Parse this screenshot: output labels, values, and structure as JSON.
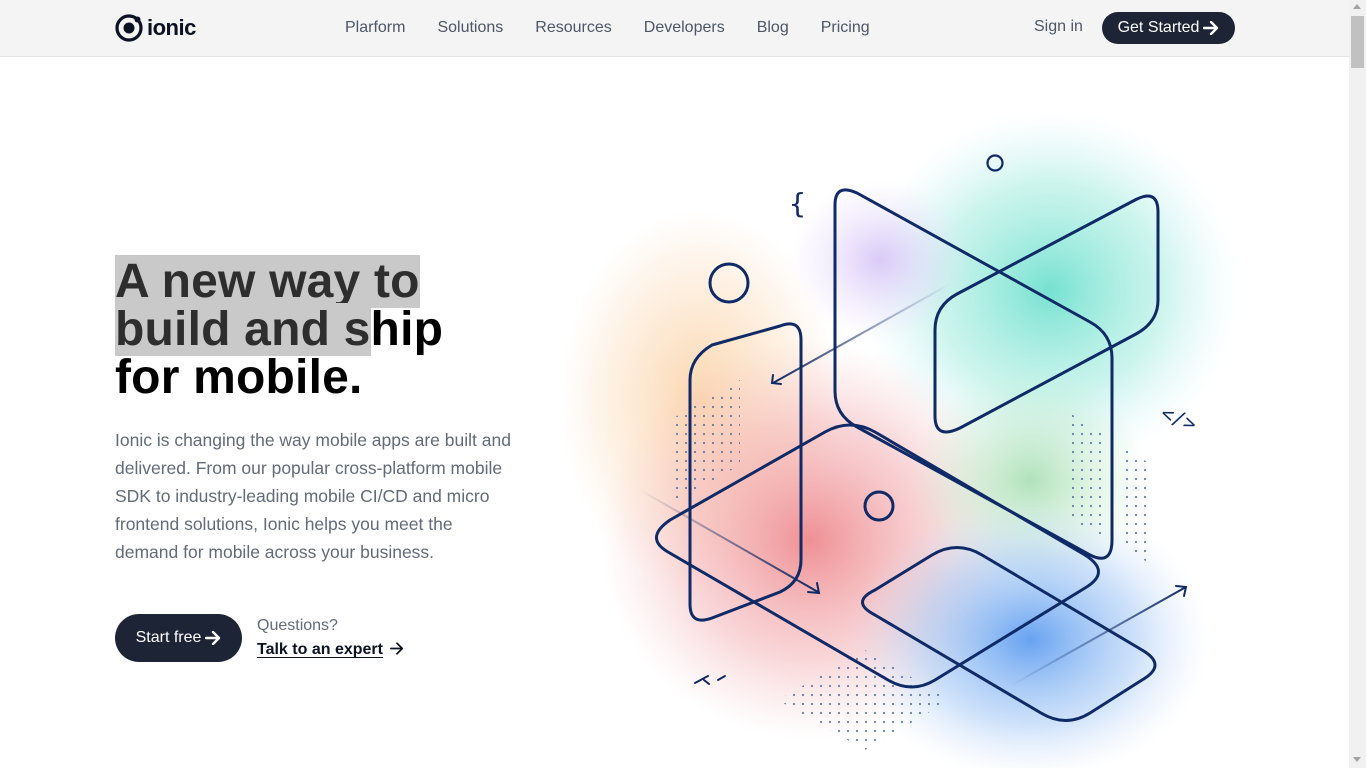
{
  "header": {
    "logo_text": "ionic",
    "nav": [
      "Plarform",
      "Solutions",
      "Resources",
      "Developers",
      "Blog",
      "Pricing"
    ],
    "signin": "Sign in",
    "get_started": "Get Started"
  },
  "hero": {
    "headline_selected_1": "A new way to",
    "headline_selected_2": "build and s",
    "headline_rest_2": "hip",
    "headline_3": "for mobile.",
    "description": "Ionic is changing the way mobile apps are built and delivered. From our popular cross-platform mobile SDK to industry-leading mobile CI/CD and micro frontend solutions, Ionic helps you meet the demand for mobile across your business.",
    "start_free": "Start free",
    "questions": "Questions?",
    "talk_expert": "Talk to an expert"
  },
  "illustration": {
    "code_brace": "{",
    "code_tag": "</>"
  },
  "icons": [
    "ionic-logo-icon",
    "arrow-right-icon",
    "scroll-up-icon",
    "scroll-down-icon"
  ],
  "colors": {
    "primary": "#1c2436",
    "header_bg": "#f4f4f4",
    "line": "#0f2a66",
    "selection": "#c9c9c9"
  }
}
